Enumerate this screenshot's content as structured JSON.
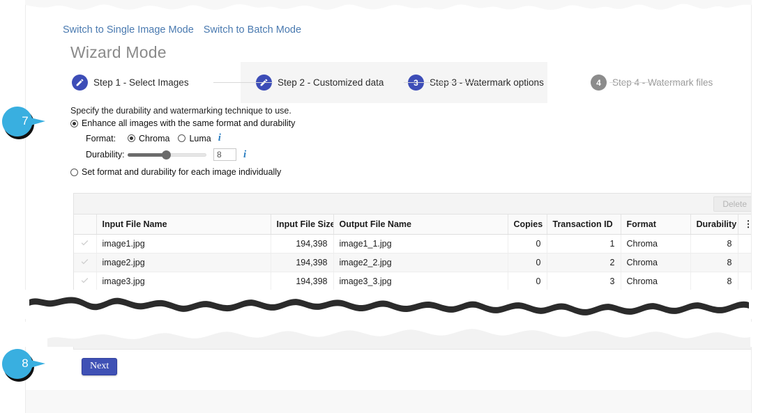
{
  "header": {
    "links": [
      {
        "label": "Switch to Single Image Mode",
        "name": "switch-single-image-mode-link"
      },
      {
        "label": "Switch to Batch Mode",
        "name": "switch-batch-mode-link"
      }
    ],
    "title": "Wizard Mode"
  },
  "wizard": {
    "steps": [
      {
        "num": "1",
        "label": "Step 1 - Select Images",
        "state": "done"
      },
      {
        "num": "2",
        "label": "Step 2 - Customized data",
        "state": "done"
      },
      {
        "num": "3",
        "label": "Step 3 - Watermark options",
        "state": "active"
      },
      {
        "num": "4",
        "label": "Step 4 - Watermark files",
        "state": "todo"
      }
    ]
  },
  "options": {
    "intro": "Specify the durability and watermarking technique to use.",
    "same_for_all_label": "Enhance all images with the same format and durability",
    "individual_label": "Set format and durability for each image individually",
    "format_label": "Format:",
    "format_options": [
      {
        "label": "Chroma",
        "selected": true
      },
      {
        "label": "Luma",
        "selected": false
      }
    ],
    "durability_label": "Durability:",
    "durability_value": "8",
    "info_icon": "info-icon"
  },
  "grid": {
    "delete_label": "Delete",
    "kebab_icon": "more-options-icon",
    "columns": [
      "Input File Name",
      "Input File Size",
      "Output File Name",
      "Copies",
      "Transaction ID",
      "Format",
      "Durability"
    ],
    "rows": [
      {
        "input_file_name": "image1.jpg",
        "input_file_size": "194,398",
        "output_file_name": "image1_1.jpg",
        "copies": "0",
        "transaction_id": "1",
        "format": "Chroma",
        "durability": "8"
      },
      {
        "input_file_name": "image2.jpg",
        "input_file_size": "194,398",
        "output_file_name": "image2_2.jpg",
        "copies": "0",
        "transaction_id": "2",
        "format": "Chroma",
        "durability": "8"
      },
      {
        "input_file_name": "image3.jpg",
        "input_file_size": "194,398",
        "output_file_name": "image3_3.jpg",
        "copies": "0",
        "transaction_id": "3",
        "format": "Chroma",
        "durability": "8"
      }
    ]
  },
  "footer": {
    "next_label": "Next"
  },
  "callouts": [
    {
      "number": "7"
    },
    {
      "number": "8"
    }
  ],
  "colors": {
    "step_active": "#3d4db7",
    "step_inactive": "#8c8c8c",
    "link": "#4a7ab0",
    "primary_button": "#3f51b5",
    "callout": "#39afe0",
    "info": "#2d7fc1"
  }
}
